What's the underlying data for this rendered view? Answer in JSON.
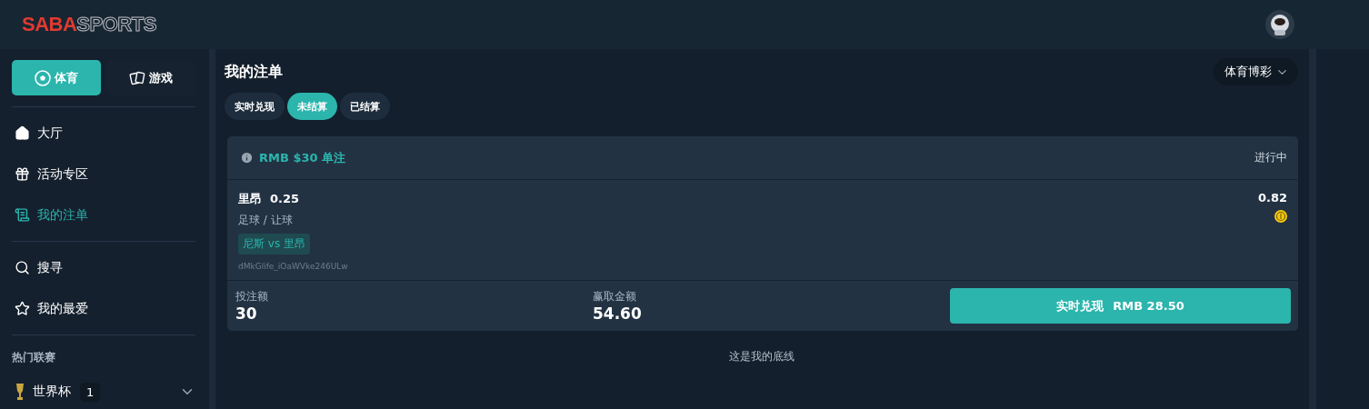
{
  "header": {
    "logo": {
      "part_1": "SABA",
      "part_2": "SPORTS"
    }
  },
  "sidebar": {
    "modes": [
      {
        "label": "体育",
        "selected": true
      },
      {
        "label": "游戏",
        "selected": false
      }
    ],
    "groups": [
      [
        {
          "label": "大厅",
          "selected": false
        },
        {
          "label": "活动专区",
          "selected": false
        },
        {
          "label": "我的注单",
          "selected": true
        }
      ],
      [
        {
          "label": "搜寻",
          "selected": false
        },
        {
          "label": "我的最爱",
          "selected": false
        }
      ]
    ],
    "section_title": "热门联赛",
    "leagues": [
      {
        "label": "世界杯",
        "count": "1",
        "expanded": false
      }
    ]
  },
  "main": {
    "title": "我的注单",
    "dropdown": "体育博彩",
    "tabs": [
      {
        "label": "实时兑现",
        "selected": false
      },
      {
        "label": "未结算",
        "selected": true
      },
      {
        "label": "已结算",
        "selected": false
      }
    ],
    "bet": {
      "title": "RMB $30 单注",
      "status": "进行中",
      "selection": "里昂",
      "handicap": "0.25",
      "odds": "0.82",
      "market": "足球 / 让球",
      "match": "尼斯 vs 里昂",
      "ref": "dMkGlife_iOaWVke246ULw",
      "stake_label": "投注额",
      "stake": "30",
      "win_label": "赢取金额",
      "win": "54.60",
      "cashout_label": "实时兑现",
      "cashout_amount": "RMB 28.50"
    },
    "footer": "这是我的底线"
  }
}
